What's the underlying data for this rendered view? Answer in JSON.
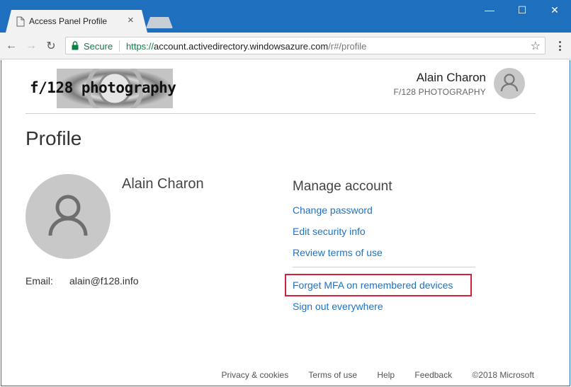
{
  "browser": {
    "tab_title": "Access Panel Profile",
    "tab_close": "×",
    "window_minimize": "—",
    "window_maximize": "☐",
    "window_close": "✕",
    "nav_back": "←",
    "nav_forward": "→",
    "nav_reload": "↻",
    "secure_label": "Secure",
    "url_scheme": "https://",
    "url_host": "account.activedirectory.windowsazure.com",
    "url_path": "/r#/profile",
    "bookmark_star": "☆"
  },
  "header": {
    "logo_text": "f/128 photography",
    "user_name": "Alain Charon",
    "org_name": "F/128 PHOTOGRAPHY"
  },
  "main": {
    "page_title": "Profile",
    "profile_name": "Alain Charon",
    "email_label": "Email:",
    "email_value": "alain@f128.info"
  },
  "manage": {
    "title": "Manage account",
    "links": [
      "Change password",
      "Edit security info",
      "Review terms of use",
      "Forget MFA on remembered devices",
      "Sign out everywhere"
    ]
  },
  "footer": {
    "links": [
      "Privacy & cookies",
      "Terms of use",
      "Help",
      "Feedback"
    ],
    "copyright": "©2018 Microsoft"
  },
  "colors": {
    "titlebar": "#1f6fbf",
    "link": "#1a73c9",
    "highlight": "#d3223c",
    "secure": "#0b8043"
  },
  "icons": {
    "tab": "page-icon",
    "secure": "lock-icon",
    "bookmark": "star-icon",
    "menu": "more-vert-icon",
    "avatar": "person-icon"
  }
}
